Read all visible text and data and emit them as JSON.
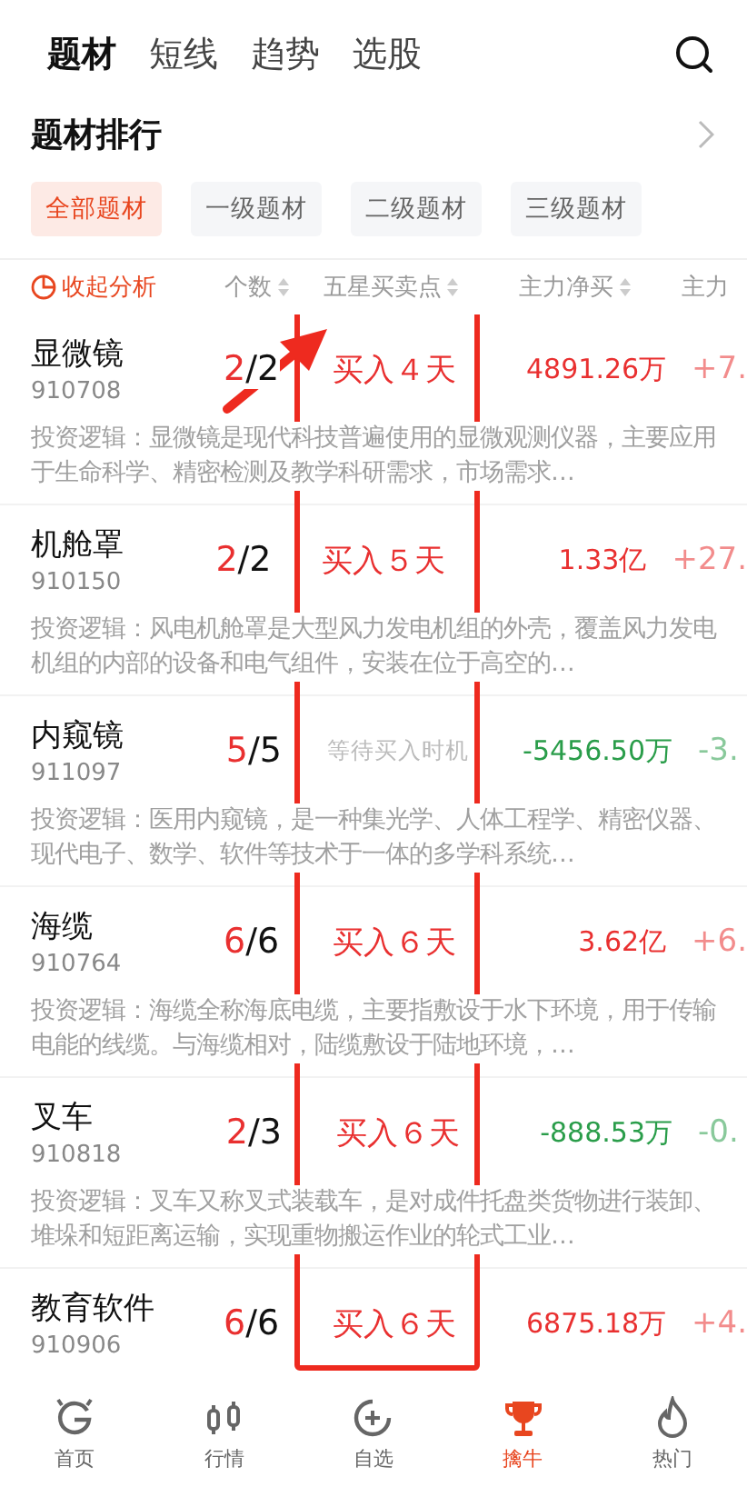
{
  "top_tabs": [
    {
      "label": "题材",
      "selected": true
    },
    {
      "label": "短线",
      "selected": false
    },
    {
      "label": "趋势",
      "selected": false
    },
    {
      "label": "选股",
      "selected": false
    }
  ],
  "section": {
    "title": "题材排行"
  },
  "filters": [
    {
      "label": "全部题材",
      "selected": true
    },
    {
      "label": "一级题材",
      "selected": false
    },
    {
      "label": "二级题材",
      "selected": false
    },
    {
      "label": "三级题材",
      "selected": false
    }
  ],
  "columns": {
    "collapse": "收起分析",
    "headers": [
      {
        "label": "个数",
        "sortable": true
      },
      {
        "label": "五星买卖点",
        "sortable": true
      },
      {
        "label": "主力净买",
        "sortable": true
      },
      {
        "label": "主力",
        "sortable": false
      }
    ]
  },
  "rows": [
    {
      "name": "显微镜",
      "code": "910708",
      "hit": "2",
      "total": "/2",
      "signal": "买入４天",
      "waiting": false,
      "net": "4891.26万",
      "rising": true,
      "column_5": "+7.",
      "logic": "投资逻辑：显微镜是现代科技普遍使用的显微观测仪器，主要应用于生命科学、精密检测及教学科研需求，市场需求…"
    },
    {
      "name": "机舱罩",
      "code": "910150",
      "hit": "2",
      "total": "/2",
      "signal": "买入５天",
      "waiting": false,
      "net": "1.33亿",
      "rising": true,
      "column_5": "+27.",
      "logic": "投资逻辑：风电机舱罩是大型风力发电机组的外壳，覆盖风力发电机组的内部的设备和电气组件，安装在位于高空的…"
    },
    {
      "name": "内窥镜",
      "code": "911097",
      "hit": "5",
      "total": "/5",
      "signal": "等待买入时机",
      "waiting": true,
      "net": "-5456.50万",
      "rising": false,
      "column_5": "-3.",
      "logic": "投资逻辑：医用内窥镜，是一种集光学、人体工程学、精密仪器、现代电子、数学、软件等技术于一体的多学科系统…"
    },
    {
      "name": "海缆",
      "code": "910764",
      "hit": "6",
      "total": "/6",
      "signal": "买入６天",
      "waiting": false,
      "net": "3.62亿",
      "rising": true,
      "column_5": "+6.",
      "logic": "投资逻辑：海缆全称海底电缆，主要指敷设于水下环境，用于传输电能的线缆。与海缆相对，陆缆敷设于陆地环境，…"
    },
    {
      "name": "叉车",
      "code": "910818",
      "hit": "2",
      "total": "/3",
      "signal": "买入６天",
      "waiting": false,
      "net": "-888.53万",
      "rising": false,
      "column_5": "-0.",
      "logic": "投资逻辑：叉车又称叉式装载车，是对成件托盘类货物进行装卸、堆垛和短距离运输，实现重物搬运作业的轮式工业…"
    },
    {
      "name": "教育软件",
      "code": "910906",
      "hit": "6",
      "total": "/6",
      "signal": "买入６天",
      "waiting": false,
      "net": "6875.18万",
      "rising": true,
      "column_5": "+4."
    }
  ],
  "bottom_nav": [
    {
      "label": "首页",
      "selected": false
    },
    {
      "label": "行情",
      "selected": false
    },
    {
      "label": "自选",
      "selected": false
    },
    {
      "label": "擒牛",
      "selected": true
    },
    {
      "label": "热门",
      "selected": false
    }
  ]
}
